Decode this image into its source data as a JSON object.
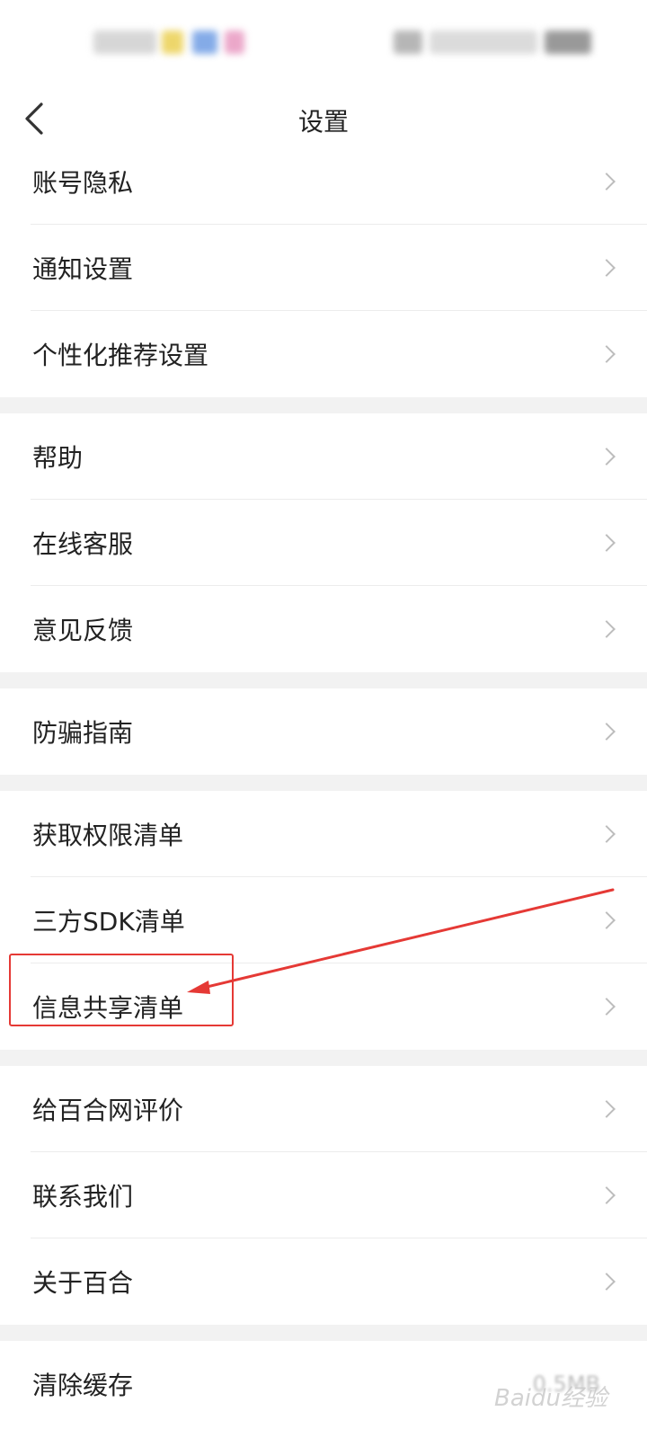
{
  "nav": {
    "title": "设置"
  },
  "groups": [
    {
      "items": [
        {
          "label": "账号隐私"
        },
        {
          "label": "通知设置"
        },
        {
          "label": "个性化推荐设置"
        }
      ]
    },
    {
      "items": [
        {
          "label": "帮助"
        },
        {
          "label": "在线客服"
        },
        {
          "label": "意见反馈"
        }
      ]
    },
    {
      "items": [
        {
          "label": "防骗指南"
        }
      ]
    },
    {
      "items": [
        {
          "label": "获取权限清单"
        },
        {
          "label": "三方SDK清单"
        },
        {
          "label": "信息共享清单"
        }
      ]
    },
    {
      "items": [
        {
          "label": "给百合网评价"
        },
        {
          "label": "联系我们"
        },
        {
          "label": "关于百合"
        }
      ]
    },
    {
      "items": [
        {
          "label": "清除缓存",
          "value": "0.5MB"
        }
      ]
    }
  ],
  "annotation": {
    "color": "#e53935"
  },
  "watermark": {
    "text": "Baidu经验"
  },
  "icons": {
    "back": "chevron-left-icon",
    "row": "chevron-right-icon"
  }
}
